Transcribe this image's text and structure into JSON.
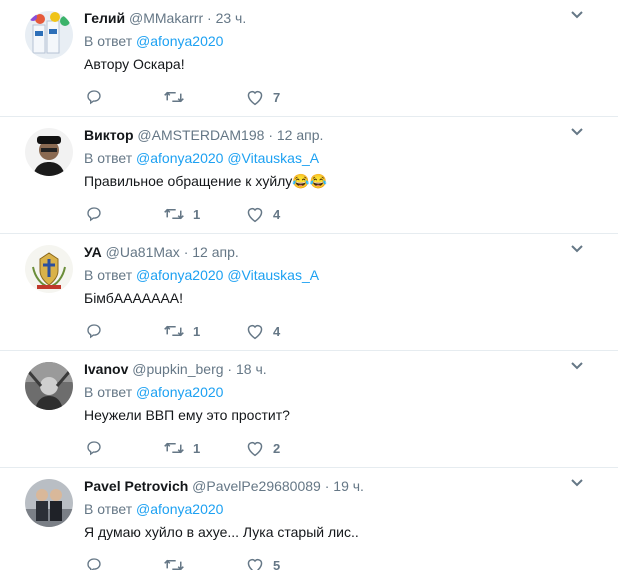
{
  "tweets": [
    {
      "name": "Гелий",
      "handle": "@MMakarrr",
      "time": "23 ч.",
      "reply_prefix": "В ответ",
      "mentions": [
        "@afonya2020"
      ],
      "text": "Автору Оскара!",
      "retweets": "",
      "likes": "7"
    },
    {
      "name": "Виктор",
      "handle": "@AMSTERDAM198",
      "time": "12 апр.",
      "reply_prefix": "В ответ",
      "mentions": [
        "@afonya2020",
        "@Vitauskas_A"
      ],
      "text": "Правильное обращение к хуйлу😂😂",
      "retweets": "1",
      "likes": "4"
    },
    {
      "name": "УА",
      "handle": "@Ua81Max",
      "time": "12 апр.",
      "reply_prefix": "В ответ",
      "mentions": [
        "@afonya2020",
        "@Vitauskas_A"
      ],
      "text": "БімбАААААAA!",
      "retweets": "1",
      "likes": "4"
    },
    {
      "name": "Ivanov",
      "handle": "@pupkin_berg",
      "time": "18 ч.",
      "reply_prefix": "В ответ",
      "mentions": [
        "@afonya2020"
      ],
      "text": "Неужели ВВП ему это простит?",
      "retweets": "1",
      "likes": "2"
    },
    {
      "name": "Pavel Petrovich",
      "handle": "@PavelPe29680089",
      "time": "19 ч.",
      "reply_prefix": "В ответ",
      "mentions": [
        "@afonya2020"
      ],
      "text": "Я думаю хуйло в ахуе... Лука старый лис..",
      "retweets": "",
      "likes": "5"
    }
  ],
  "separator": "·",
  "colors": {
    "link": "#1da1f2",
    "muted": "#657786",
    "text": "#14171a",
    "border": "#e6ecf0"
  },
  "icons": {
    "reply": "reply-icon",
    "retweet": "retweet-icon",
    "like": "heart-icon",
    "menu": "chevron-down-icon"
  }
}
